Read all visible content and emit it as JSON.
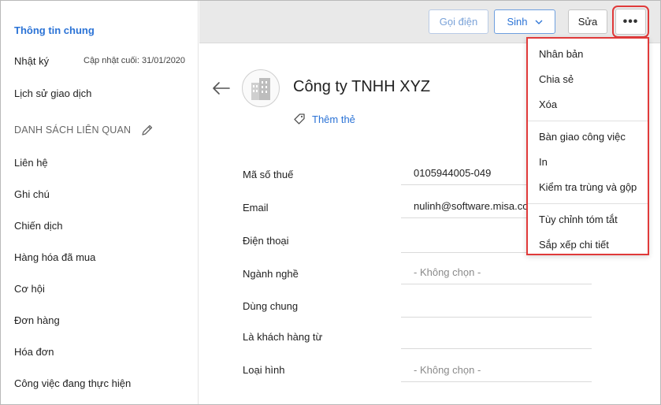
{
  "sidebar": {
    "general_info": "Thông tin chung",
    "log": "Nhật ký",
    "last_updated": "Cập nhật cuối: 31/01/2020",
    "transaction_history": "Lịch sử giao dịch",
    "related_section": "DANH SÁCH LIÊN QUAN",
    "related_items": [
      "Liên hệ",
      "Ghi chú",
      "Chiến dịch",
      "Hàng hóa đã mua",
      "Cơ hội",
      "Đơn hàng",
      "Hóa đơn",
      "Công việc đang thực hiện"
    ]
  },
  "toolbar": {
    "call_label": "Gọi điện",
    "generate_label": "Sinh",
    "edit_label": "Sửa",
    "more_label": "•••"
  },
  "record": {
    "company_name": "Công ty TNHH XYZ",
    "add_tag_label": "Thêm thẻ",
    "fields": [
      {
        "label": "Mã số thuế",
        "value": "0105944005-049"
      },
      {
        "label": "Email",
        "value": "nulinh@software.misa.com.vn"
      },
      {
        "label": "Điện thoại",
        "value": ""
      },
      {
        "label": "Ngành nghề",
        "value": "- Không chọn -"
      },
      {
        "label": "Dùng chung",
        "value": ""
      },
      {
        "label": "Là khách hàng từ",
        "value": ""
      },
      {
        "label": "Loại hình",
        "value": "- Không chọn -"
      }
    ]
  },
  "more_menu": {
    "items": [
      "Nhân bản",
      "Chia sẻ",
      "Xóa",
      "Bàn giao công việc",
      "In",
      "Kiểm tra trùng và gộp",
      "Tùy chỉnh tóm tắt",
      "Sắp xếp chi tiết"
    ]
  },
  "colors": {
    "accent": "#2b73d6",
    "highlight": "#e03a3a"
  }
}
